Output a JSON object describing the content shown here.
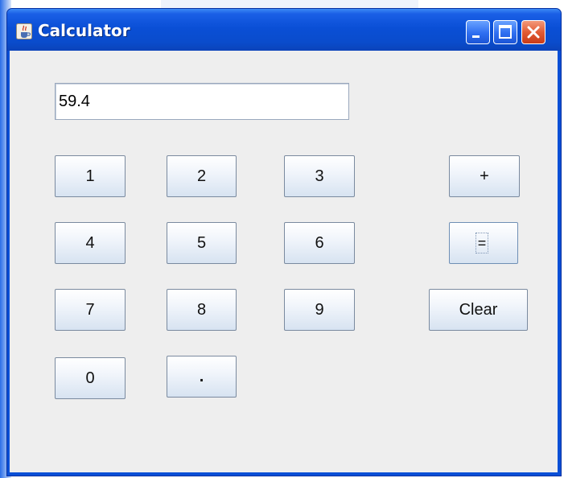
{
  "window": {
    "title": "Calculator",
    "title_color": "#ffffff",
    "titlebar_color": "#0a4fd6",
    "controls": [
      "minimize-icon",
      "maximize-icon",
      "close-icon"
    ]
  },
  "display": {
    "value": "59.4"
  },
  "keypad": {
    "digits": [
      "1",
      "2",
      "3",
      "4",
      "5",
      "6",
      "7",
      "8",
      "9",
      "0",
      "."
    ],
    "plus": "+",
    "equals": "=",
    "clear": "Clear"
  },
  "colors": {
    "client_background": "#eeeeee",
    "button_gradient_bottom": "#d7e3f1",
    "close_button": "#e25c35"
  }
}
